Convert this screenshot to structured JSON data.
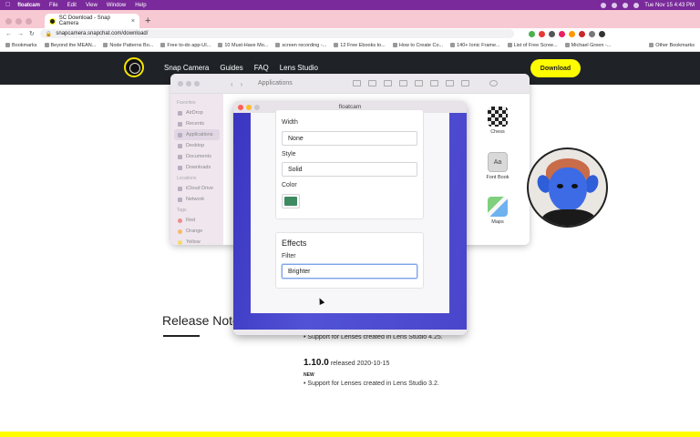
{
  "menubar": {
    "app": "floatcam",
    "items": [
      "File",
      "Edit",
      "View",
      "Window",
      "Help"
    ],
    "clock": "Tue Nov 15  4:43 PM"
  },
  "browser": {
    "tab_title": "SC Download - Snap Camera",
    "url": "snapcamera.snapchat.com/download/",
    "bookmarks": [
      "Bookmarks",
      "Beyond the MEAN...",
      "Node Patterns Bo...",
      "Free to-do app-UI...",
      "10 Must-Have Mo...",
      "screen recording -...",
      "12 Free Ebooks to...",
      "How to Create Co...",
      "140+ Ionic Frame...",
      "List of Free Scree...",
      "Michael Green -..."
    ],
    "other_bookmarks": "Other Bookmarks"
  },
  "snap": {
    "nav": [
      "Snap Camera",
      "Guides",
      "FAQ",
      "Lens Studio"
    ],
    "download_label": "Download",
    "release_title": "Release Note",
    "bullet1": "Support for Lenses created in Lens Studio 4.25.",
    "version": "1.10.0",
    "released": "released 2020-10-15",
    "new_tag": "NEW",
    "bullet2": "Support for Lenses created in Lens Studio 3.2."
  },
  "finder": {
    "title": "Applications",
    "favorites_label": "Favorites",
    "favorites": [
      "AirDrop",
      "Recents",
      "Applications",
      "Desktop",
      "Documents",
      "Downloads"
    ],
    "locations_label": "Locations",
    "locations": [
      "iCloud Drive",
      "Network"
    ],
    "tags_label": "Tags",
    "tags": [
      "Red",
      "Orange",
      "Yellow"
    ],
    "apps": [
      "Chess",
      "Font Book",
      "Maps"
    ]
  },
  "floatcam": {
    "title": "floatcam",
    "width_label": "Width",
    "width_value": "None",
    "style_label": "Style",
    "style_value": "Solid",
    "color_label": "Color",
    "color_value": "#3e8a62",
    "effects_title": "Effects",
    "filter_label": "Filter",
    "filter_value": "Brighter"
  }
}
